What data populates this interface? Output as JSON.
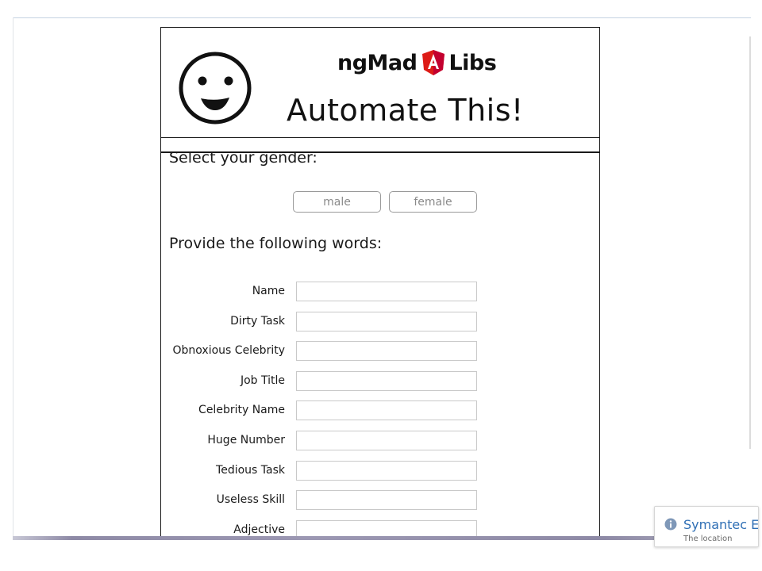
{
  "app": {
    "brand_left": "ngMad",
    "brand_right": "Libs",
    "headline": "Automate This!"
  },
  "gender": {
    "prompt": "Select your gender:",
    "options": [
      "male",
      "female"
    ]
  },
  "words": {
    "prompt": "Provide the following words:",
    "fields": [
      {
        "label": "Name",
        "value": ""
      },
      {
        "label": "Dirty Task",
        "value": ""
      },
      {
        "label": "Obnoxious Celebrity",
        "value": ""
      },
      {
        "label": "Job Title",
        "value": ""
      },
      {
        "label": "Celebrity Name",
        "value": ""
      },
      {
        "label": "Huge Number",
        "value": ""
      },
      {
        "label": "Tedious Task",
        "value": ""
      },
      {
        "label": "Useless Skill",
        "value": ""
      },
      {
        "label": "Adjective",
        "value": ""
      }
    ]
  },
  "notification": {
    "title": "Symantec E",
    "subtitle": "The location"
  },
  "icons": {
    "logo": "smiley-face-icon",
    "brand_mark": "angular-shield-icon",
    "notification": "info-icon"
  },
  "colors": {
    "angular_red": "#dd1b16",
    "angular_dark_red": "#c3002f",
    "toast_blue": "#2f6fb5"
  }
}
